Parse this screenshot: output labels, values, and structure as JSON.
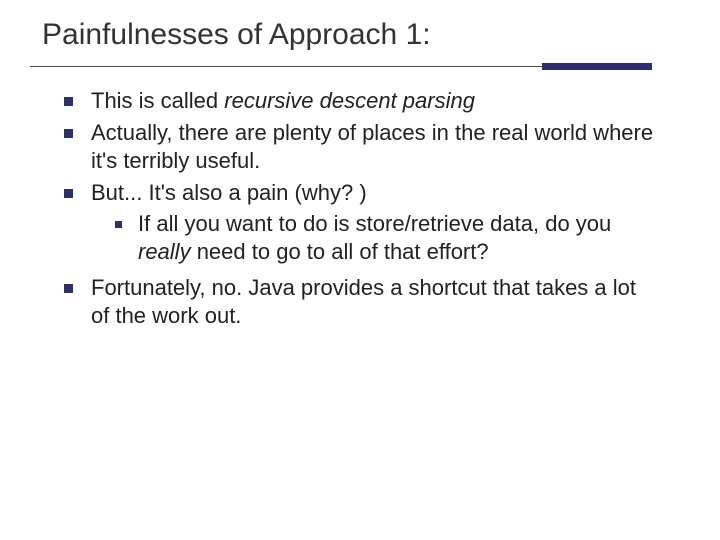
{
  "title": "Painfulnesses of Approach 1:",
  "bullets": {
    "b1": {
      "pre": "This is called ",
      "em": "recursive descent parsing"
    },
    "b2": "Actually, there are plenty of places in the real world where it's terribly useful.",
    "b3": {
      "text": "But...  It's also a pain (why? )",
      "sub": {
        "pre": "If all you want to do is store/retrieve data, do you ",
        "em": "really",
        "post": " need to go to all of that effort?"
      }
    },
    "b4": "Fortunately, no.  Java provides a shortcut that takes a lot of the work out."
  }
}
